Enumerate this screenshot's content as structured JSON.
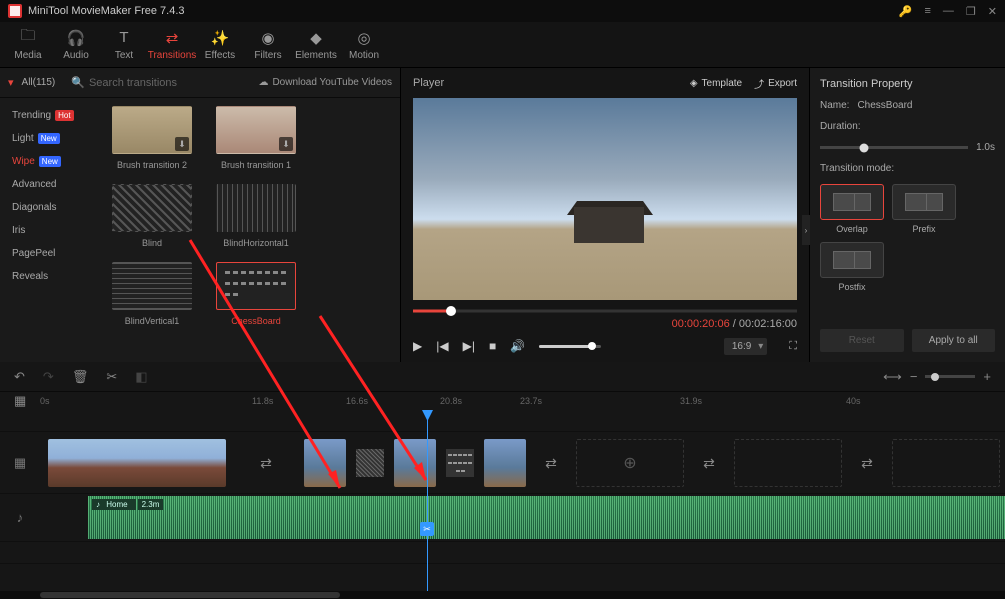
{
  "app": {
    "title": "MiniTool MovieMaker Free 7.4.3"
  },
  "tools": [
    {
      "id": "media",
      "label": "Media",
      "icon": "folder-icon"
    },
    {
      "id": "audio",
      "label": "Audio",
      "icon": "headphones-icon"
    },
    {
      "id": "text",
      "label": "Text",
      "icon": "text-icon"
    },
    {
      "id": "transitions",
      "label": "Transitions",
      "icon": "transitions-icon",
      "active": true
    },
    {
      "id": "effects",
      "label": "Effects",
      "icon": "effects-icon"
    },
    {
      "id": "filters",
      "label": "Filters",
      "icon": "filters-icon"
    },
    {
      "id": "elements",
      "label": "Elements",
      "icon": "elements-icon"
    },
    {
      "id": "motion",
      "label": "Motion",
      "icon": "motion-icon"
    }
  ],
  "browser": {
    "filter": "All(115)",
    "search_placeholder": "Search transitions",
    "download_link": "Download YouTube Videos",
    "categories": [
      {
        "label": "Trending",
        "badge": "Hot"
      },
      {
        "label": "Light",
        "badge": "New"
      },
      {
        "label": "Wipe",
        "badge": "New",
        "active": true
      },
      {
        "label": "Advanced"
      },
      {
        "label": "Diagonals"
      },
      {
        "label": "Iris"
      },
      {
        "label": "PagePeel"
      },
      {
        "label": "Reveals"
      }
    ],
    "items": [
      {
        "label": "Brush transition 2",
        "style": "brush1",
        "dl": true
      },
      {
        "label": "Brush transition 1",
        "style": "brush2",
        "dl": true
      },
      {
        "label": "Blind",
        "style": "stripes"
      },
      {
        "label": "BlindHorizontal1",
        "style": "stripes-h"
      },
      {
        "label": "BlindVertical1",
        "style": "stripes-v"
      },
      {
        "label": "ChessBoard",
        "style": "dots",
        "selected": true
      }
    ]
  },
  "player": {
    "title": "Player",
    "template_btn": "Template",
    "export_btn": "Export",
    "time_current": "00:00:20:06",
    "time_total": "00:02:16:00",
    "aspect": "16:9"
  },
  "props": {
    "title": "Transition Property",
    "name_label": "Name:",
    "name_value": "ChessBoard",
    "duration_label": "Duration:",
    "duration_value": "1.0s",
    "mode_label": "Transition mode:",
    "modes": [
      {
        "label": "Overlap",
        "active": true
      },
      {
        "label": "Prefix"
      },
      {
        "label": "Postfix"
      }
    ],
    "reset": "Reset",
    "apply_all": "Apply to all"
  },
  "timeline": {
    "ruler": [
      "0s",
      "11.8s",
      "16.6s",
      "20.8s",
      "23.7s",
      "31.9s",
      "40s"
    ],
    "ruler_pos": [
      40,
      252,
      346,
      440,
      520,
      680,
      846
    ],
    "audio_name": "Home",
    "audio_dur": "2.3m"
  }
}
